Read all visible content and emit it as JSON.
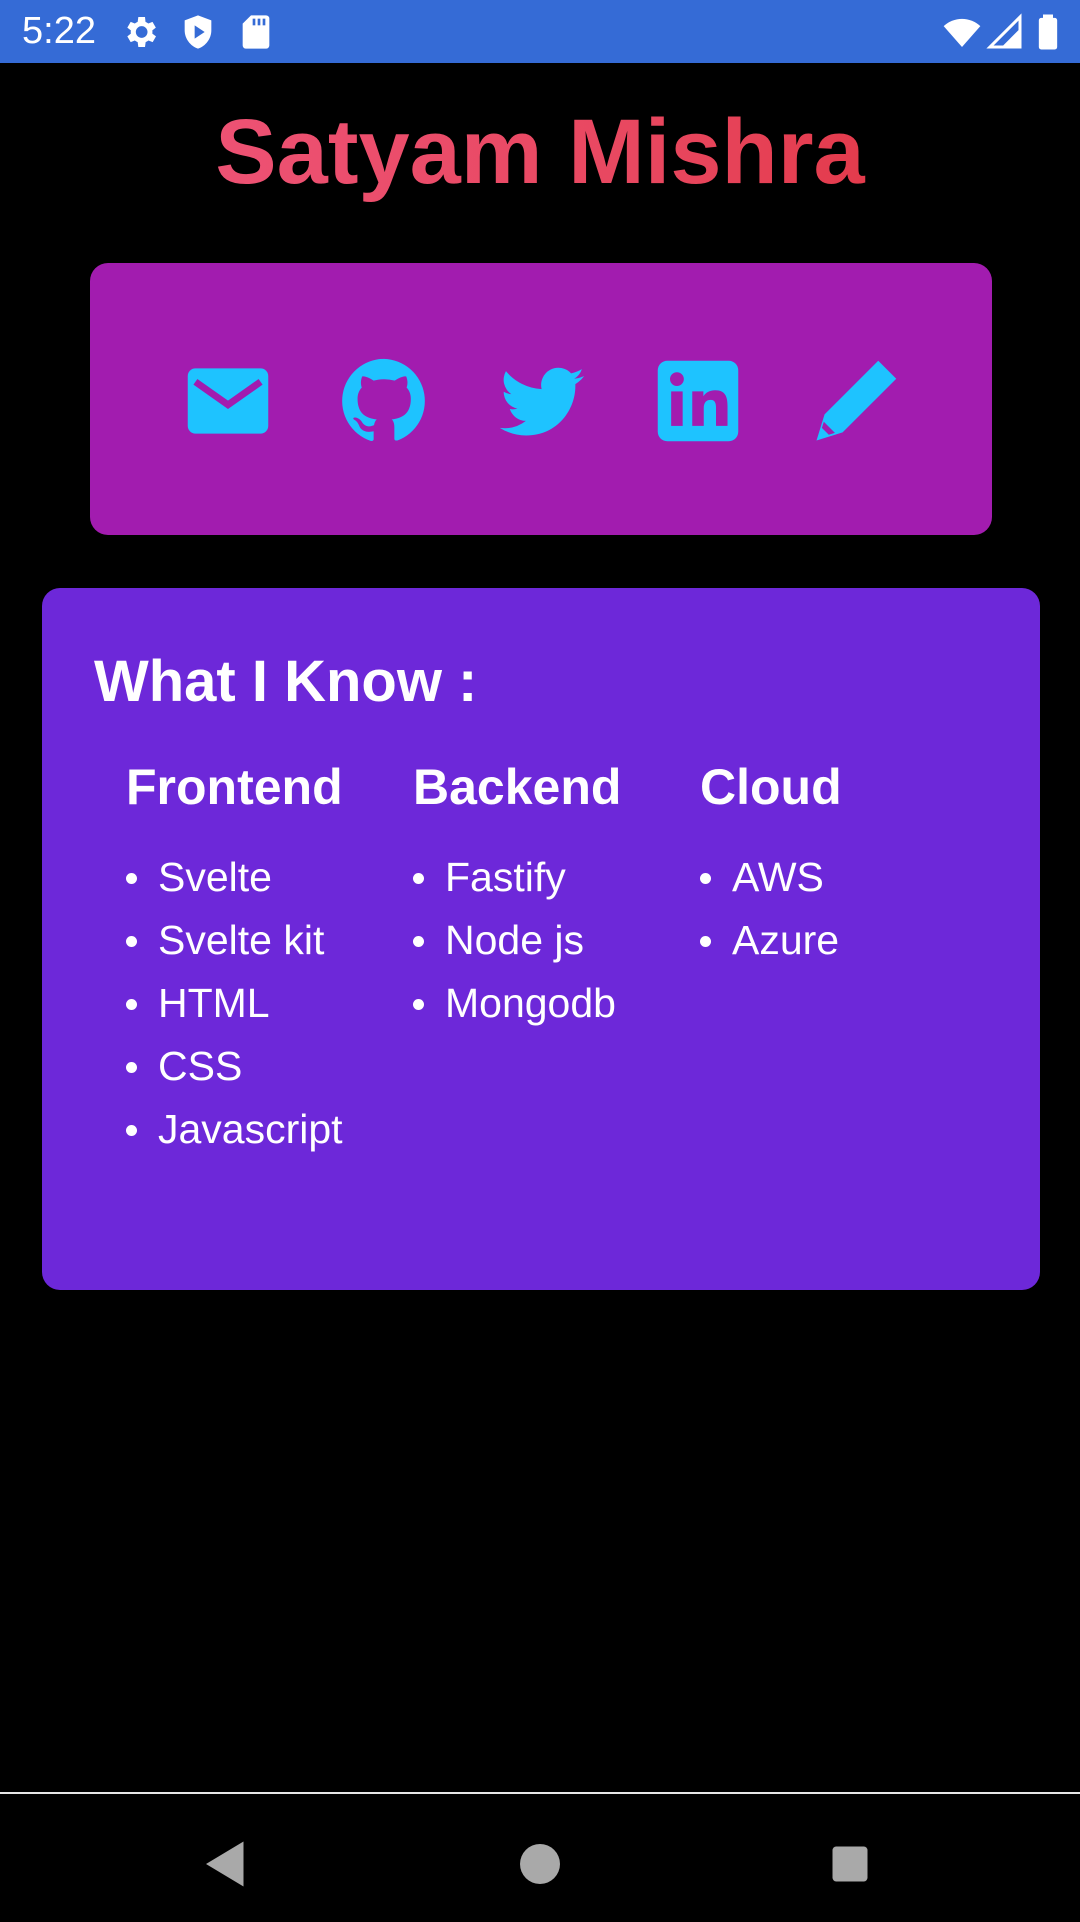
{
  "status_bar": {
    "time": "5:22",
    "icons": [
      "settings-icon",
      "shield-play-icon",
      "sd-card-icon",
      "wifi-icon",
      "cellular-signal-icon",
      "battery-icon"
    ]
  },
  "title": "Satyam Mishra",
  "socials": {
    "icons": [
      "email-icon",
      "github-icon",
      "twitter-icon",
      "linkedin-icon",
      "pencil-icon"
    ],
    "icon_color": "#1ec3ff",
    "card_color": "#a21caf"
  },
  "skills": {
    "heading": "What I Know :",
    "card_color": "#6d28d9",
    "columns": [
      {
        "title": "Frontend",
        "items": [
          "Svelte",
          "Svelte kit",
          "HTML",
          "CSS",
          "Javascript"
        ]
      },
      {
        "title": "Backend",
        "items": [
          "Fastify",
          "Node js",
          "Mongodb"
        ]
      },
      {
        "title": "Cloud",
        "items": [
          "AWS",
          "Azure"
        ]
      }
    ]
  },
  "nav_bar": {
    "buttons": [
      "back-icon",
      "home-icon",
      "recents-icon"
    ]
  },
  "colors": {
    "status_bar": "#356bd6",
    "title_gradient_start": "#f0577e",
    "title_gradient_end": "#df2f3a"
  }
}
